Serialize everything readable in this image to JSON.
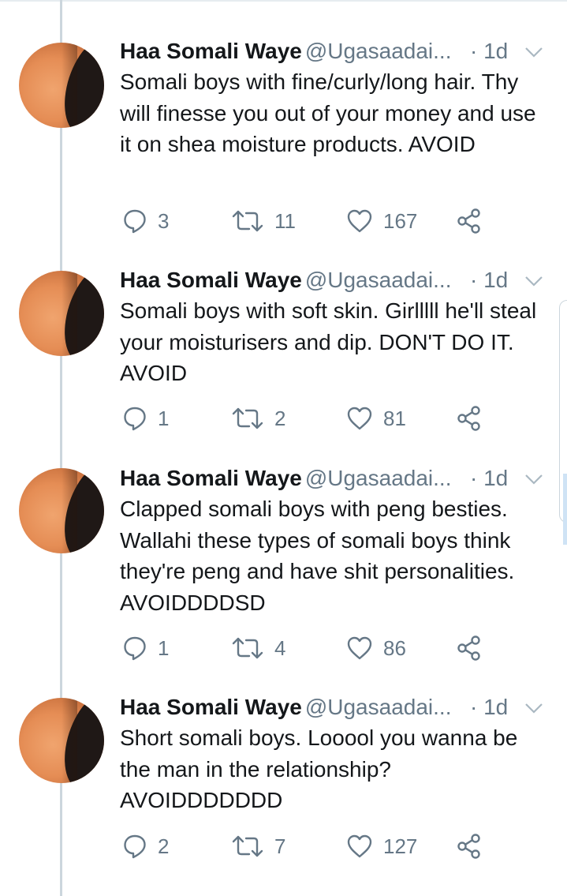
{
  "colors": {
    "text": "#14171a",
    "secondary": "#657786",
    "thread_line": "#ccd6dd"
  },
  "tweets": [
    {
      "name": "Haa Somali Waye",
      "handle": "@Ugasaadai...",
      "time": "· 1d",
      "text": "Somali boys with fine/curly/long hair. Thy will finesse you out of your money and use it on shea moisture products. AVOID",
      "replies": "3",
      "retweets": "11",
      "likes": "167"
    },
    {
      "name": "Haa Somali Waye",
      "handle": "@Ugasaadai...",
      "time": "· 1d",
      "text": "Somali boys with soft skin. Girlllll he'll steal your moisturisers and dip. DON'T DO IT. AVOID",
      "replies": "1",
      "retweets": "2",
      "likes": "81"
    },
    {
      "name": "Haa Somali Waye",
      "handle": "@Ugasaadai...",
      "time": "· 1d",
      "text": "Clapped somali boys with peng besties. Wallahi these types of somali boys think they're peng and have shit personalities. AVOIDDDDSD",
      "replies": "1",
      "retweets": "4",
      "likes": "86"
    },
    {
      "name": "Haa Somali Waye",
      "handle": "@Ugasaadai...",
      "time": "· 1d",
      "text": "Short somali boys. Looool you wanna be the man in the relationship? AVOIDDDDDDD",
      "replies": "2",
      "retweets": "7",
      "likes": "127"
    }
  ]
}
